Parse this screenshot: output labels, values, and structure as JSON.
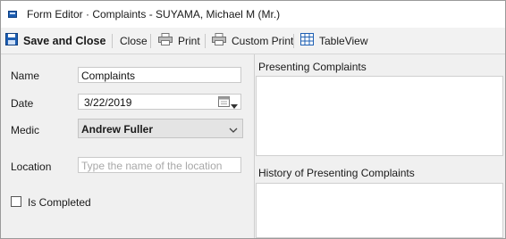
{
  "window": {
    "title": "Form Editor · Complaints - SUYAMA, Michael  M (Mr.)"
  },
  "toolbar": {
    "save_close_label": "Save and Close",
    "close_label": "Close",
    "print_label": "Print",
    "custom_print_label": "Custom Print",
    "table_view_label": "TableView"
  },
  "form": {
    "name_label": "Name",
    "name_value": "Complaints",
    "date_label": "Date",
    "date_value": "3/22/2019",
    "medic_label": "Medic",
    "medic_value": "Andrew Fuller",
    "location_label": "Location",
    "location_placeholder": "Type the name of the location",
    "is_completed_label": "Is Completed",
    "is_completed_checked": false
  },
  "sections": {
    "presenting_label": "Presenting Complaints",
    "history_label": "History of Presenting Complaints"
  },
  "colors": {
    "accent": "#1e5fb3",
    "panel_bg": "#f0f0f0",
    "toolbar_bg": "#f2f2f2",
    "combo_bg": "#e4e4e4"
  }
}
